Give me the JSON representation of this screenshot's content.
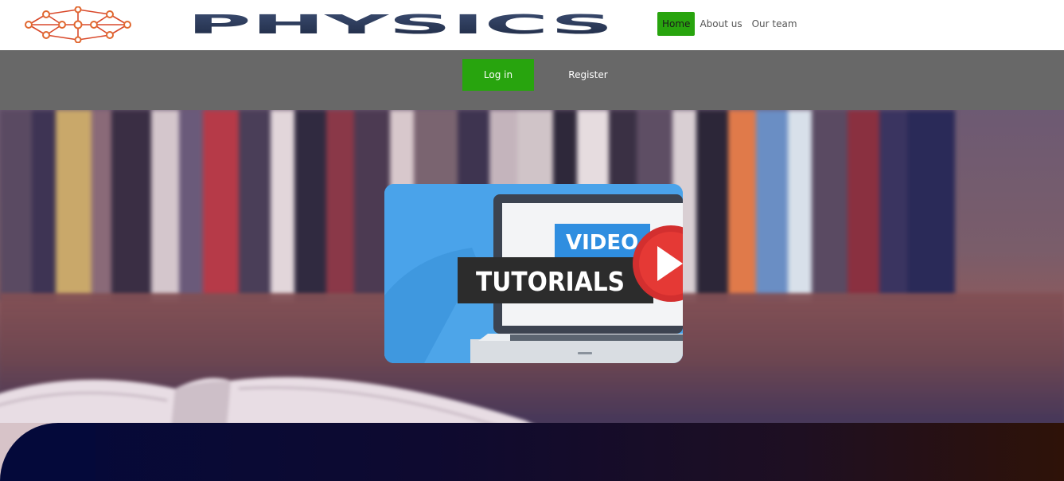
{
  "header": {
    "logo_icon": "molecule-network-icon",
    "wordmark": "PHYSICS",
    "nav": [
      {
        "label": "Home",
        "active": true
      },
      {
        "label": "About us",
        "active": false
      },
      {
        "label": "Our team",
        "active": false
      }
    ]
  },
  "auth": {
    "login_label": "Log in",
    "register_label": "Register"
  },
  "hero": {
    "video_card": {
      "line1": "VIDEO",
      "line2": "TUTORIALS",
      "icon": "play-icon"
    }
  },
  "colors": {
    "accent_green": "#28a40e",
    "authbar_gray": "#686868",
    "wordmark_navy": "#2b3a5a",
    "card_blue": "#4aa3ea",
    "play_red": "#d32f2f"
  }
}
